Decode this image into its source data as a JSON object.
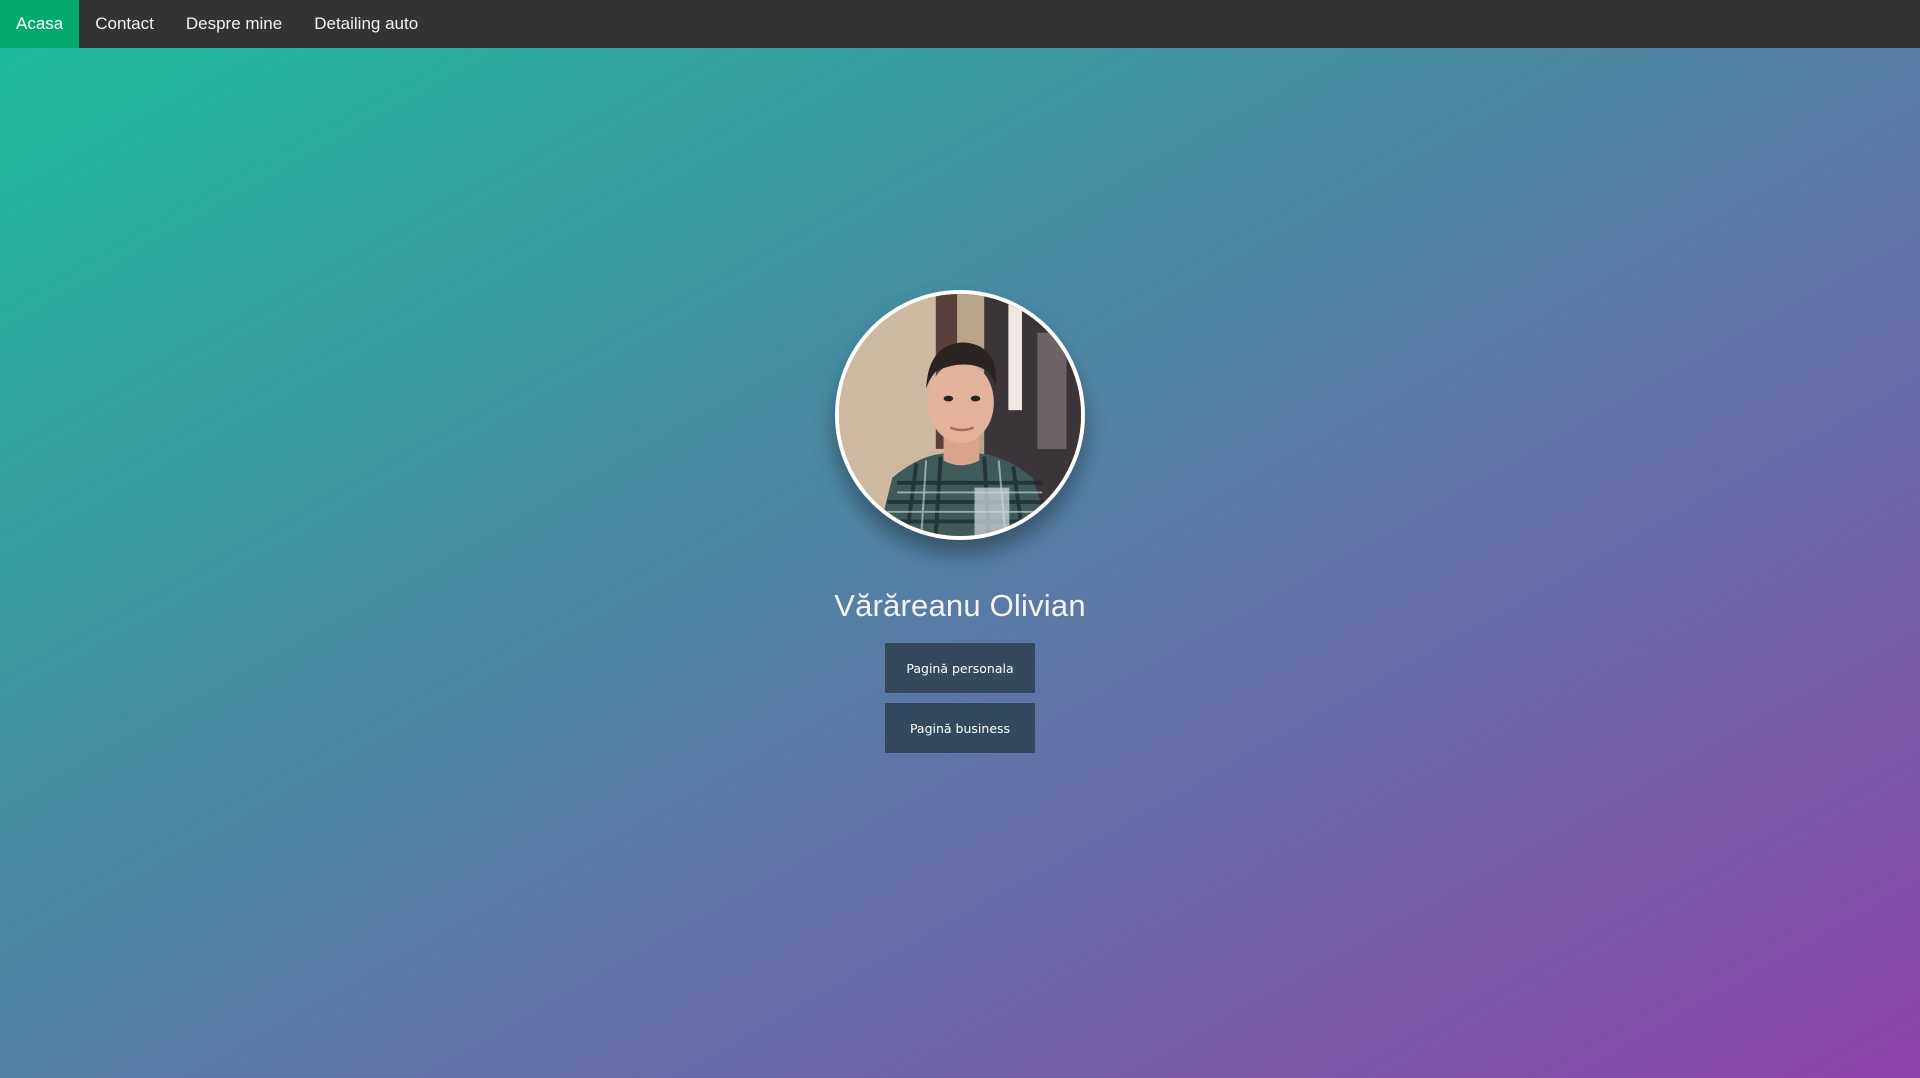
{
  "nav": {
    "items": [
      {
        "label": "Acasa",
        "active": true
      },
      {
        "label": "Contact",
        "active": false
      },
      {
        "label": "Despre mine",
        "active": false
      },
      {
        "label": "Detailing auto",
        "active": false
      }
    ]
  },
  "profile": {
    "avatar_icon": "profile-photo",
    "name": "Vărăreanu Olivian",
    "buttons": {
      "personal_label": "Pagină personala",
      "business_label": "Pagină business"
    }
  },
  "colors": {
    "gradient_start": "#1abc9c",
    "gradient_end": "#8e44ad",
    "nav_bg": "#333333",
    "nav_active": "#04aa6d",
    "button_bg": "#34495e"
  }
}
